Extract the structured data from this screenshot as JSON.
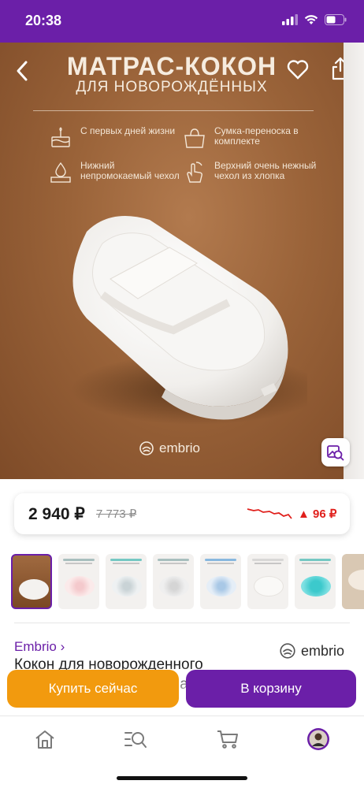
{
  "status_bar": {
    "time": "20:38"
  },
  "hero": {
    "title_line1": "МАТРАС-КОКОН",
    "title_line2": "ДЛЯ НОВОРОЖДЁННЫХ",
    "features": [
      {
        "icon": "cake-icon",
        "text": "С первых дней жизни"
      },
      {
        "icon": "bag-icon",
        "text": "Сумка-переноска в комплекте"
      },
      {
        "icon": "waterproof-icon",
        "text": "Нижний непромокаемый чехол"
      },
      {
        "icon": "hand-touch-icon",
        "text": "Верхний очень нежный чехол из хлопка"
      }
    ],
    "brand": "embrio"
  },
  "price": {
    "current": "2 940 ₽",
    "old": "7 773 ₽",
    "change": "▲ 96 ₽",
    "colors": {
      "change": "#e0201c",
      "graph": "#e0201c"
    }
  },
  "thumbnails": {
    "count_visible": 8,
    "selected_index": 0
  },
  "seller": {
    "link": "Embrio ›",
    "logo_text": "embrio"
  },
  "product": {
    "title": "Кокон для новорожденного позиционер для малыша для"
  },
  "actions": {
    "buy_now": "Купить сейчас",
    "add_to_cart": "В корзину"
  },
  "colors": {
    "brand": "#6b1fa8",
    "accent_orange": "#f29a0e"
  },
  "bottom_nav": [
    {
      "icon": "home-icon"
    },
    {
      "icon": "catalog-search-icon"
    },
    {
      "icon": "cart-icon"
    },
    {
      "icon": "profile-avatar-icon"
    }
  ]
}
